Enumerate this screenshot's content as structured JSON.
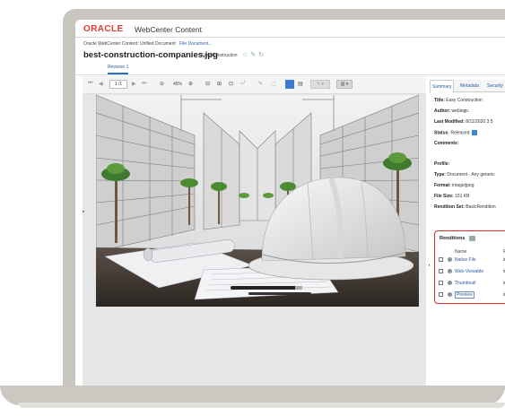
{
  "header": {
    "logo": "ORACLE",
    "app_name": "WebCenter Content"
  },
  "breadcrumb": {
    "root": "Oracle WebCenter Content: Unified Document",
    "link": "File Document..."
  },
  "document": {
    "title": "best-construction-companies.jpg",
    "subtitle": "Easy Construction"
  },
  "tabs": {
    "revision": "Revision 1"
  },
  "viewer_toolbar": {
    "page_value": "1 /1",
    "zoom": "45%"
  },
  "panel": {
    "tabs": [
      "Summary",
      "Metadata",
      "Security"
    ],
    "fields": [
      {
        "label": "Title:",
        "value": "Easy Construction"
      },
      {
        "label": "Author:",
        "value": "weblogic"
      },
      {
        "label": "Last Modified:",
        "value": "8/11/2020 3:5"
      },
      {
        "label": "Status:",
        "value": "Released"
      },
      {
        "label": "Comments:",
        "value": ""
      },
      {
        "label": "Profile:",
        "value": ""
      },
      {
        "label": "Type:",
        "value": "Document - Any generic"
      },
      {
        "label": "Format:",
        "value": "image/jpeg"
      },
      {
        "label": "File Size:",
        "value": "151 KB"
      },
      {
        "label": "Rendition Set:",
        "value": "BasicRendition"
      }
    ],
    "renditions": {
      "title": "Renditions",
      "col_name": "Name",
      "col_format": "Fo",
      "rows": [
        {
          "name": "Native File",
          "format": "im"
        },
        {
          "name": "Web-Viewable",
          "format": "im"
        },
        {
          "name": "Thumbnail",
          "format": "im"
        },
        {
          "name": "Preview",
          "format": "im"
        }
      ]
    }
  },
  "colors": {
    "brand_red": "#e33a2f",
    "link_blue": "#2a5aa8",
    "highlight_red": "#d9302a",
    "bezel": "#c9c6c0"
  }
}
